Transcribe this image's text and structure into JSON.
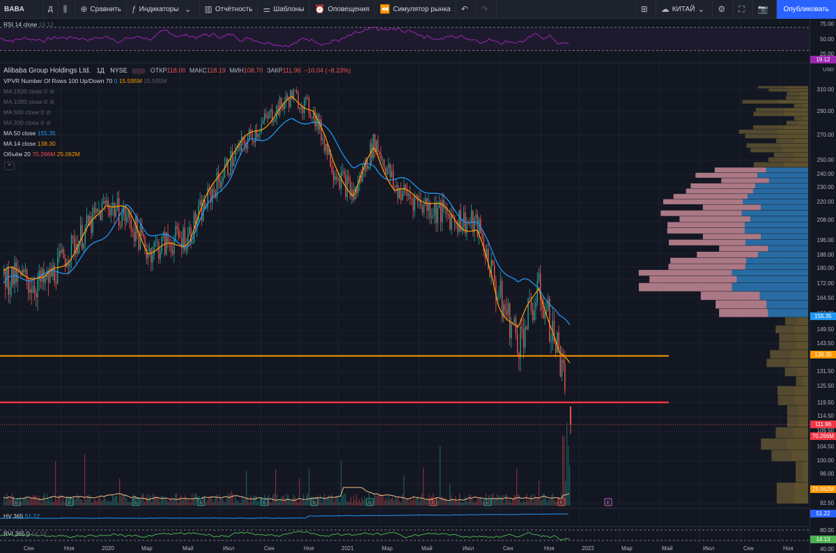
{
  "toolbar": {
    "symbol": "BABA",
    "interval": "Д",
    "compare": "Сравнить",
    "indicators": "Индикаторы",
    "reports": "Отчётность",
    "templates": "Шаблоны",
    "alerts": "Оповещения",
    "replay": "Симулятор рынка",
    "exchange": "КИТАЙ",
    "publish": "Опубликовать"
  },
  "rsi": {
    "label": "RSI 14 close",
    "value": "19.12",
    "ticks": [
      "75.00",
      "50.00",
      "25.00"
    ],
    "tag": "19.12"
  },
  "main": {
    "title": "Alibaba Group Holdings Ltd.",
    "interval": "1Д",
    "exchange": "NYSE",
    "open_label": "ОТКР",
    "open": "118.00",
    "high_label": "МАКС",
    "high": "118.19",
    "low_label": "МИН",
    "low": "108.70",
    "close_label": "ЗАКР",
    "close": "111.96",
    "change": "−10.04 (−8.23%)",
    "vpvr_label": "VPVR Number Of Rows 100 Up/Down 70",
    "vpvr_v1": "0",
    "vpvr_v2": "15.595M",
    "vpvr_v3": "15.595M",
    "ma1500": "MA 1500 close 0",
    "ma1000": "MA 1000 close 0",
    "ma500": "MA 500 close 0",
    "ma200": "MA 200 close 0",
    "ma50_label": "MA 50 close",
    "ma50": "155.35",
    "ma14_label": "MA 14 close",
    "ma14": "138.30",
    "vol_label": "Объём 20",
    "vol1": "70.266M",
    "vol2": "25.062M",
    "currency": "USD"
  },
  "price_ticks": [
    "310.00",
    "290.00",
    "270.00",
    "250.00",
    "240.00",
    "230.00",
    "220.00",
    "208.00",
    "196.00",
    "188.00",
    "180.00",
    "172.00",
    "164.50",
    "157.00",
    "149.50",
    "143.50",
    "131.50",
    "125.50",
    "119.50",
    "114.50",
    "109.50",
    "104.50",
    "100.00",
    "96.00",
    "92.50"
  ],
  "tags": {
    "ma50": "155.35",
    "ma14": "138.30",
    "close": "111.96",
    "vol1": "70.266M",
    "vol2": "25.062M"
  },
  "hv": {
    "label": "HV 365",
    "value": "51.22",
    "tag": "51.22"
  },
  "rvi": {
    "label": "RVI 365 0",
    "value": "14.13",
    "ticks": [
      "80.00",
      "40.00"
    ],
    "tag": "14.13"
  },
  "time_axis": [
    "Сен",
    "Ноя",
    "2020",
    "Мар",
    "Май",
    "Июл",
    "Сен",
    "Ноя",
    "2021",
    "Мар",
    "Май",
    "Июл",
    "Сен",
    "Ноя",
    "2022",
    "Мар",
    "Май",
    "Июл",
    "Сен",
    "Ноя"
  ],
  "colors": {
    "background": "#131722",
    "ma50": "#2196f3",
    "ma14": "#ff9800",
    "rsi": "#9c27b0",
    "rvi": "#4caf50",
    "support_orange": "#ff9800",
    "support_red": "#f23645",
    "accent": "#2962ff"
  },
  "earnings_marker": "E",
  "chart_data": {
    "type": "line",
    "title": "Alibaba Group Holdings Ltd.",
    "series": [
      {
        "name": "MA 14 close",
        "x": [
          "2019-08",
          "2019-10",
          "2020-01",
          "2020-02",
          "2020-03",
          "2020-05",
          "2020-07",
          "2020-08",
          "2020-10",
          "2020-11",
          "2020-12",
          "2021-01",
          "2021-02",
          "2021-03",
          "2021-05",
          "2021-07",
          "2021-08",
          "2021-09",
          "2021-10",
          "2021-11"
        ],
        "values": [
          175,
          170,
          220,
          210,
          190,
          200,
          250,
          270,
          305,
          290,
          245,
          225,
          265,
          230,
          215,
          205,
          165,
          145,
          168,
          138
        ]
      },
      {
        "name": "MA 50 close",
        "x": [
          "2019-08",
          "2019-10",
          "2020-01",
          "2020-02",
          "2020-03",
          "2020-05",
          "2020-07",
          "2020-08",
          "2020-10",
          "2020-11",
          "2020-12",
          "2021-01",
          "2021-02",
          "2021-03",
          "2021-05",
          "2021-07",
          "2021-08",
          "2021-09",
          "2021-10",
          "2021-11"
        ],
        "values": [
          168,
          172,
          200,
          212,
          202,
          198,
          235,
          265,
          285,
          280,
          265,
          245,
          250,
          238,
          222,
          210,
          185,
          165,
          168,
          155
        ]
      }
    ],
    "horizontal_levels": [
      138.3,
      119.5
    ],
    "ylim": [
      90,
      320
    ]
  }
}
